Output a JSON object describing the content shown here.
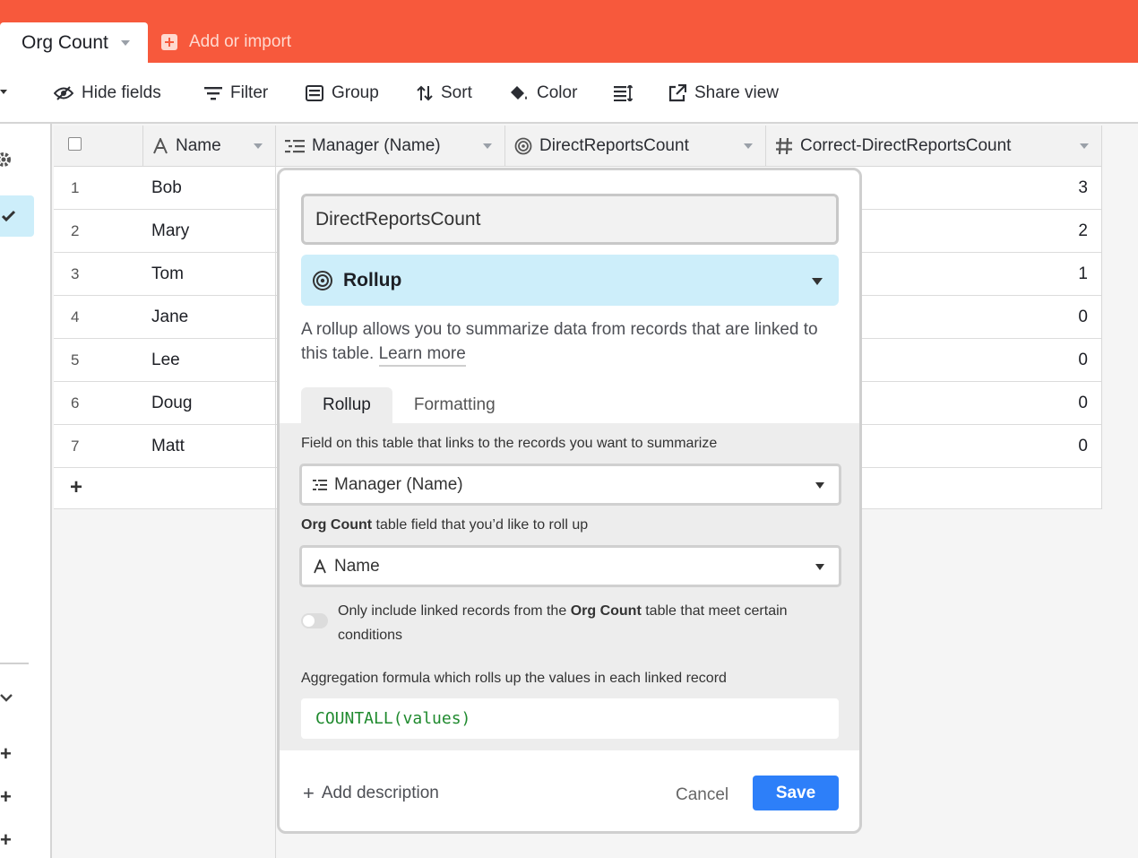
{
  "top_bar": {
    "active_tab": "Org Count",
    "add_import": "Add or import"
  },
  "toolbar": {
    "hide_fields": "Hide fields",
    "filter": "Filter",
    "group": "Group",
    "sort": "Sort",
    "color": "Color",
    "share_view": "Share view"
  },
  "grid": {
    "columns": [
      {
        "label": "Name",
        "icon": "text-a-icon"
      },
      {
        "label": "Manager (Name)",
        "icon": "lookup-icon"
      },
      {
        "label": "DirectReportsCount",
        "icon": "rollup-icon"
      },
      {
        "label": "Correct-DirectReportsCount",
        "icon": "hash-icon"
      }
    ],
    "rows": [
      {
        "num": "1",
        "name": "Bob",
        "correct": "3"
      },
      {
        "num": "2",
        "name": "Mary",
        "correct": "2"
      },
      {
        "num": "3",
        "name": "Tom",
        "correct": "1"
      },
      {
        "num": "4",
        "name": "Jane",
        "correct": "0"
      },
      {
        "num": "5",
        "name": "Lee",
        "correct": "0"
      },
      {
        "num": "6",
        "name": "Doug",
        "correct": "0"
      },
      {
        "num": "7",
        "name": "Matt",
        "correct": "0"
      }
    ],
    "add_row": "+"
  },
  "dialog": {
    "field_name": "DirectReportsCount",
    "field_type": "Rollup",
    "description_text": "A rollup allows you to summarize data from records that are linked to this table.",
    "learn_more": "Learn more",
    "tabs": [
      "Rollup",
      "Formatting"
    ],
    "link_field_label": "Field on this table that links to the records you want to summarize",
    "link_field_value": "Manager (Name)",
    "rollup_field_label_table": "Org Count",
    "rollup_field_label_rest": "table field that you’d like to roll up",
    "rollup_field_value": "Name",
    "condition_label_pre": "Only include linked records from the",
    "condition_label_table": "Org Count",
    "condition_label_post": "table that meet certain conditions",
    "aggregation_label": "Aggregation formula which rolls up the values in each linked record",
    "formula": "COUNTALL(values)",
    "add_description": "Add description",
    "cancel": "Cancel",
    "save": "Save"
  },
  "colors": {
    "brand": "#f7593c",
    "rollup_bg": "#cdeefa",
    "save": "#2d7ff9",
    "formula_text": "#1f8a2e"
  }
}
